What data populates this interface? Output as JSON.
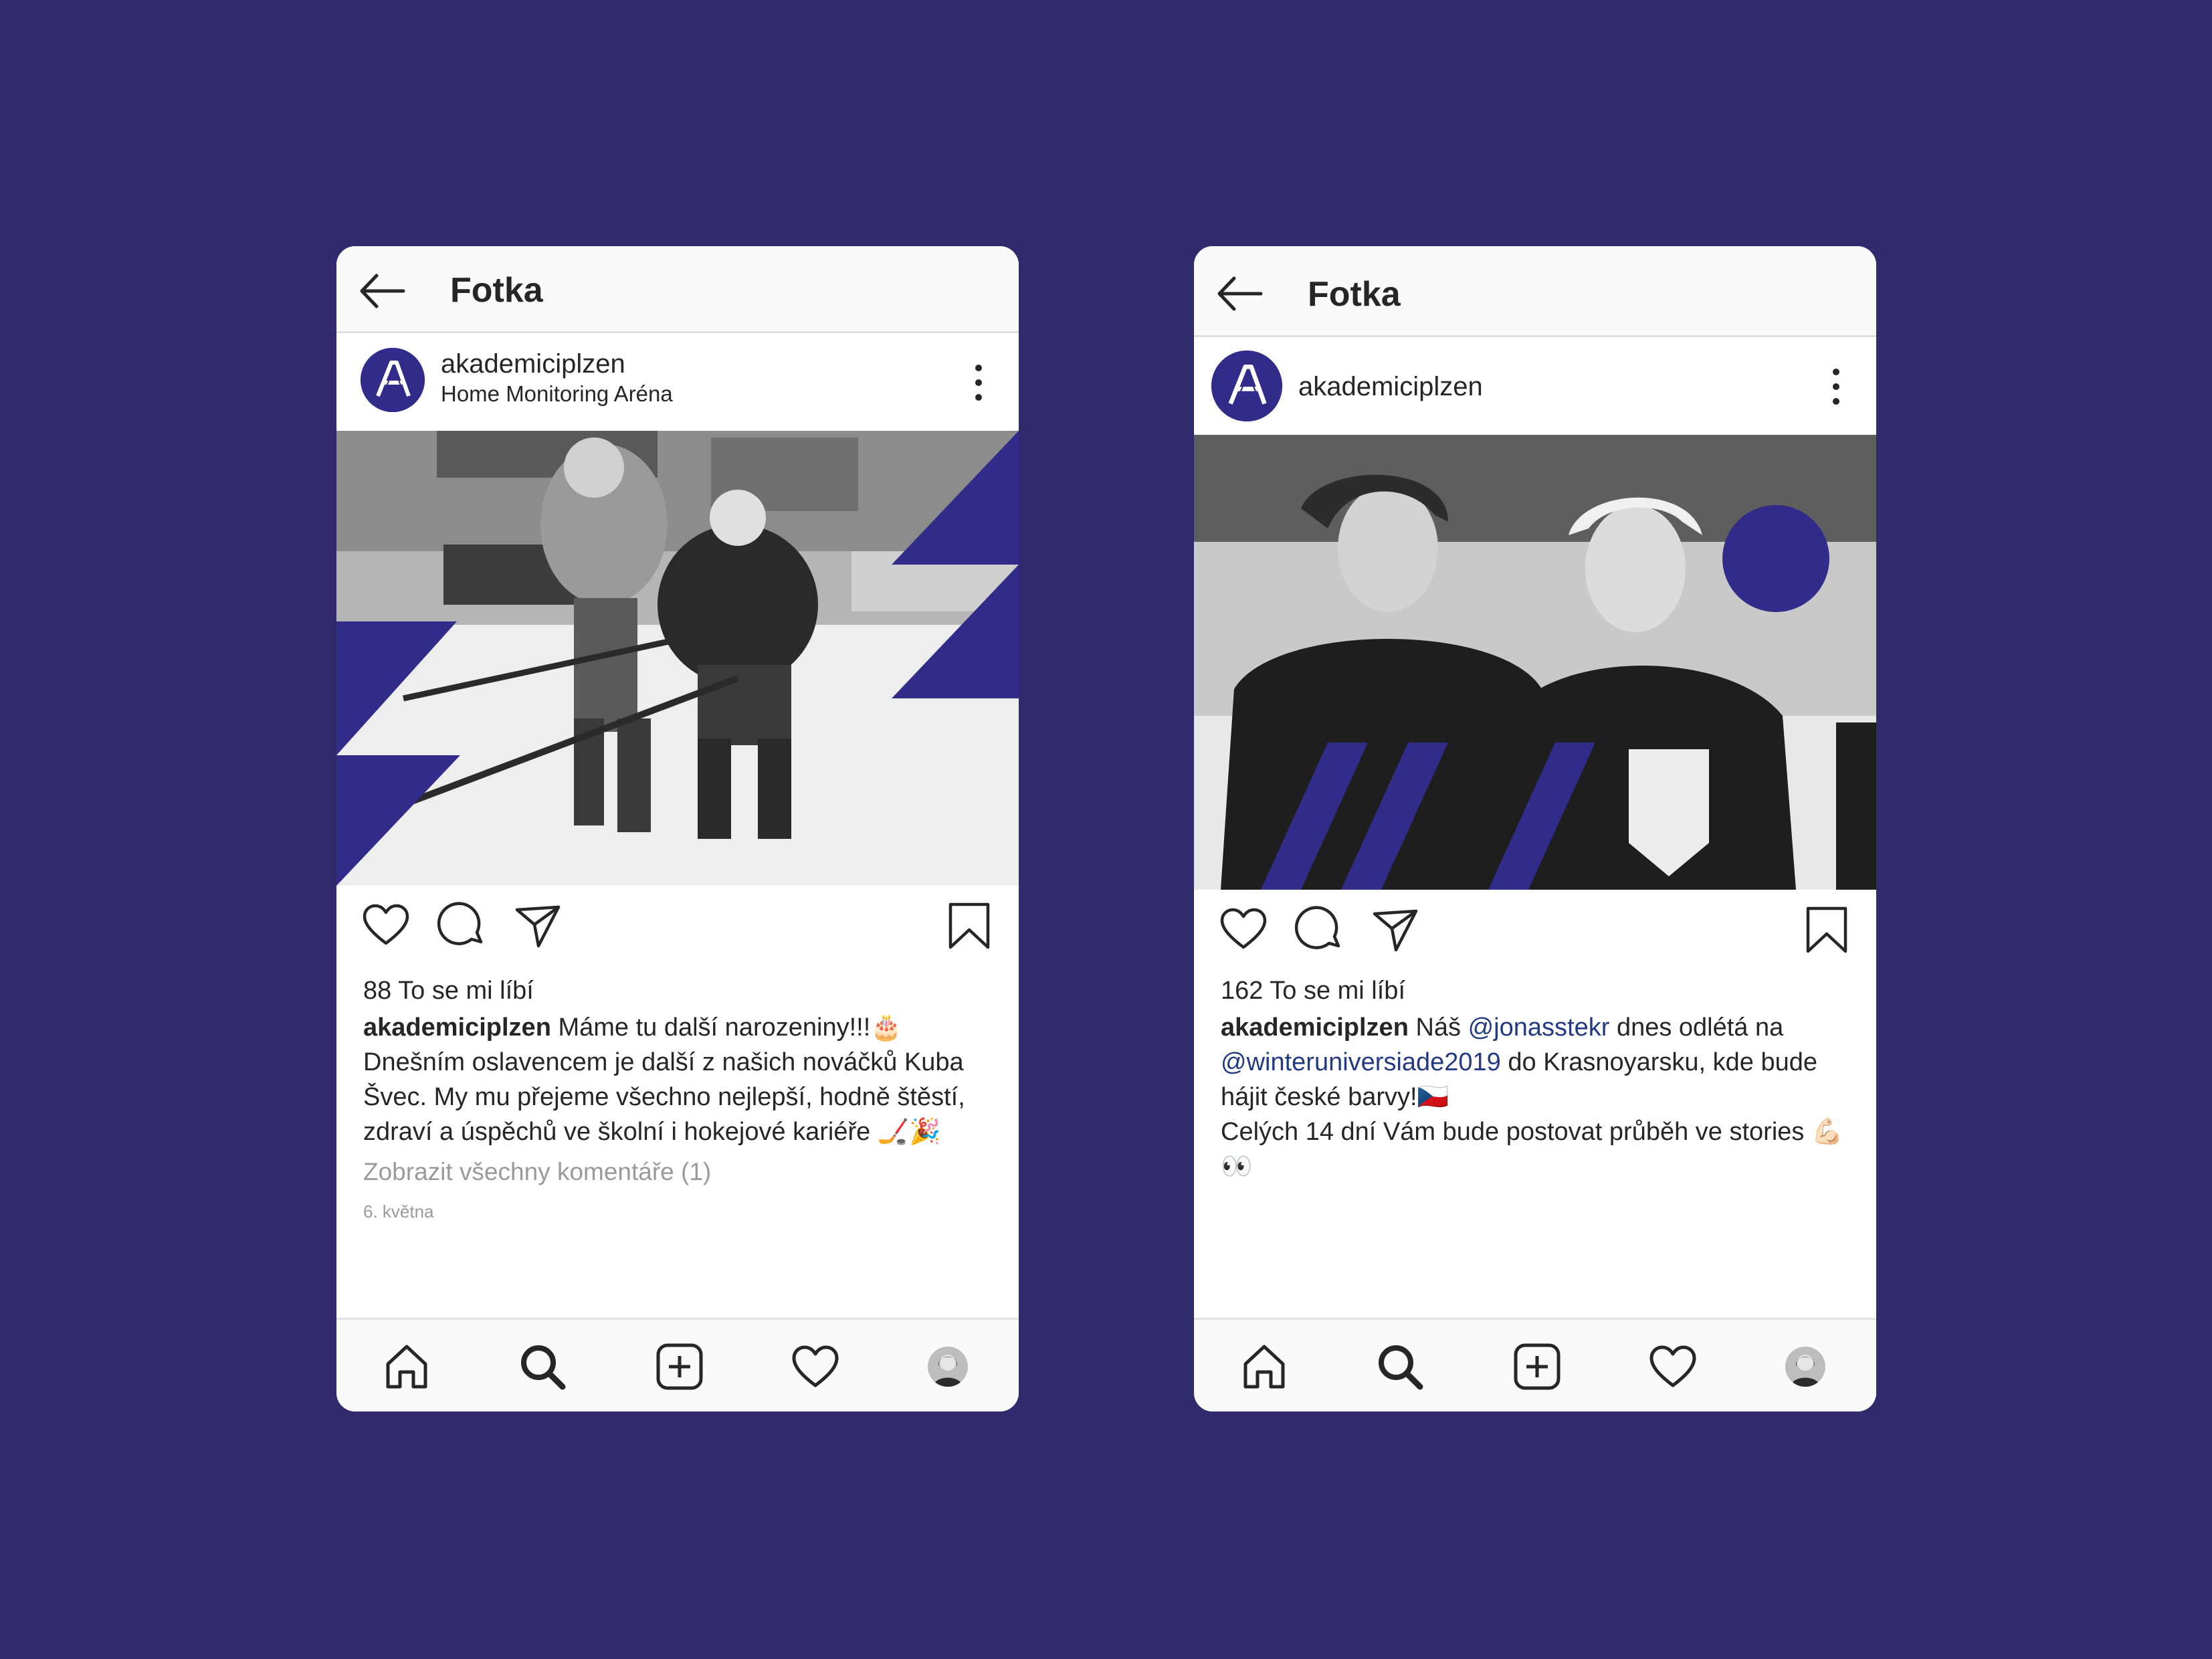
{
  "accent": "#312b8a",
  "background": "#312b6d",
  "phones": [
    {
      "topbar": {
        "title": "Fotka",
        "back_icon": "arrow-left-icon"
      },
      "post": {
        "username": "akademiciplzen",
        "location": "Home Monitoring Aréna",
        "likes": "88 To se mi líbí",
        "caption_user": "akademiciplzen",
        "caption_text": "Máme tu další narozeniny!!!🎂 Dnešním oslavencem je další z našich nováčků Kuba Švec. My mu přejeme všechno nejlepší, hodně štěstí, zdraví a úspěchů ve školní i hokejové kariéře 🏒🎉",
        "comments_link": "Zobrazit všechny komentáře (1)",
        "date": "6. května"
      }
    },
    {
      "topbar": {
        "title": "Fotka",
        "back_icon": "arrow-left-icon"
      },
      "post": {
        "username": "akademiciplzen",
        "likes": "162 To se mi líbí",
        "caption_user": "akademiciplzen",
        "caption_pre": "Náš",
        "mention_1": "@jonasstekr",
        "caption_mid_1": "dnes odlétá na",
        "mention_2": "@winteruniversiade2019",
        "caption_mid_2": "do Krasnoyarsku, kde bude hájit české barvy!🇨🇿",
        "caption_line_2": "Celých 14 dní Vám bude postovat průběh ve stories 💪🏻👀"
      }
    }
  ],
  "icons": {
    "actions": [
      "heart-icon",
      "comment-icon",
      "share-icon",
      "bookmark-icon"
    ],
    "nav": [
      "home-icon",
      "search-icon",
      "add-post-icon",
      "activity-heart-icon",
      "profile-avatar"
    ]
  }
}
